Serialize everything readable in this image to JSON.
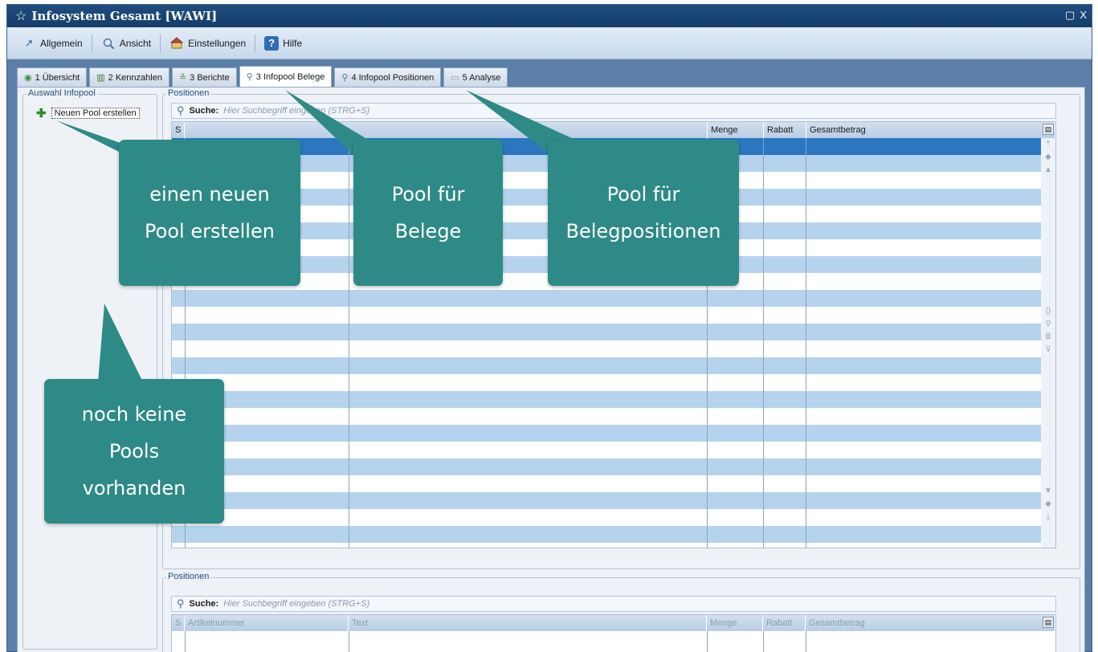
{
  "window": {
    "title": "Infosystem Gesamt [WAWI]",
    "restore_glyph": "▢",
    "close_glyph": "X"
  },
  "toolbar": {
    "items": [
      {
        "label": "Allgemein",
        "icon": "arrow-icon"
      },
      {
        "label": "Ansicht",
        "icon": "view-icon"
      },
      {
        "label": "Einstellungen",
        "icon": "settings-icon"
      },
      {
        "label": "Hilfe",
        "icon": "help-icon"
      }
    ]
  },
  "tabs": [
    {
      "label": "1 Übersicht",
      "icon": "overview-icon"
    },
    {
      "label": "2 Kennzahlen",
      "icon": "kpi-icon"
    },
    {
      "label": "3 Berichte",
      "icon": "report-icon"
    },
    {
      "label": "3 Infopool Belege",
      "icon": "search-icon",
      "active": true
    },
    {
      "label": "4 Infopool Positionen",
      "icon": "search-icon"
    },
    {
      "label": "5 Analyse",
      "icon": "analysis-icon"
    }
  ],
  "left_panel": {
    "group_label": "Auswahl Infopool",
    "new_pool_label": "Neuen Pool erstellen"
  },
  "top_grid": {
    "group_label": "Positionen",
    "search_label": "Suche:",
    "search_placeholder": "Hier Suchbegriff eingeben (STRG+S)",
    "columns": [
      "S",
      "",
      "Menge",
      "Rabatt",
      "Gesamtbetrag"
    ]
  },
  "bottom_grid": {
    "group_label": "Positionen",
    "search_label": "Suche:",
    "search_placeholder": "Hier Suchbegriff eingeben (STRG+S)",
    "columns": [
      "S",
      "Artikelnummer",
      "Text",
      "Menge",
      "Rabatt",
      "Gesamtbetrag"
    ]
  },
  "callouts": {
    "new_pool": [
      "einen neuen",
      "Pool erstellen"
    ],
    "belege": [
      "Pool für",
      "Belege"
    ],
    "positionen": [
      "Pool für",
      "Belegpositionen"
    ],
    "no_pools": [
      "noch keine",
      "Pools",
      "vorhanden"
    ]
  },
  "colors": {
    "callout": "#2e8a86",
    "row_alt": "#b6d3ee",
    "row_selected": "#2a77c0",
    "titlebar": "#1f4e80"
  }
}
